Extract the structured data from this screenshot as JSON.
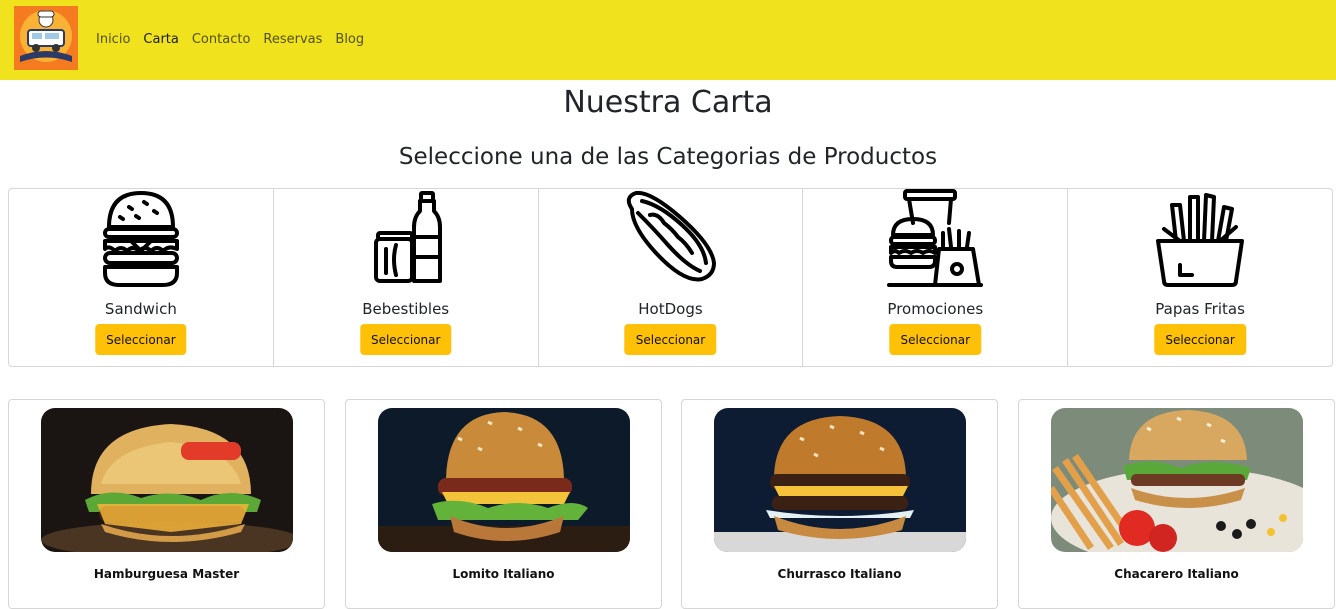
{
  "nav": {
    "links": [
      "Inicio",
      "Carta",
      "Contacto",
      "Reservas",
      "Blog"
    ]
  },
  "page": {
    "title": "Nuestra Carta",
    "subtitle": "Seleccione una de las Categorias de Productos"
  },
  "categories": [
    {
      "name": "Sandwich",
      "button": "Seleccionar",
      "icon": "burger-icon"
    },
    {
      "name": "Bebestibles",
      "button": "Seleccionar",
      "icon": "drinks-icon"
    },
    {
      "name": "HotDogs",
      "button": "Seleccionar",
      "icon": "hotdog-icon"
    },
    {
      "name": "Promociones",
      "button": "Seleccionar",
      "icon": "combo-icon"
    },
    {
      "name": "Papas Fritas",
      "button": "Seleccionar",
      "icon": "fries-icon"
    }
  ],
  "products": [
    {
      "name": "Hamburguesa Master"
    },
    {
      "name": "Lomito Italiano"
    },
    {
      "name": "Churrasco Italiano"
    },
    {
      "name": "Chacarero Italiano"
    }
  ],
  "colors": {
    "navbar": "#f0e21c",
    "button": "#ffc107",
    "logo_bg": "#f47b20"
  }
}
